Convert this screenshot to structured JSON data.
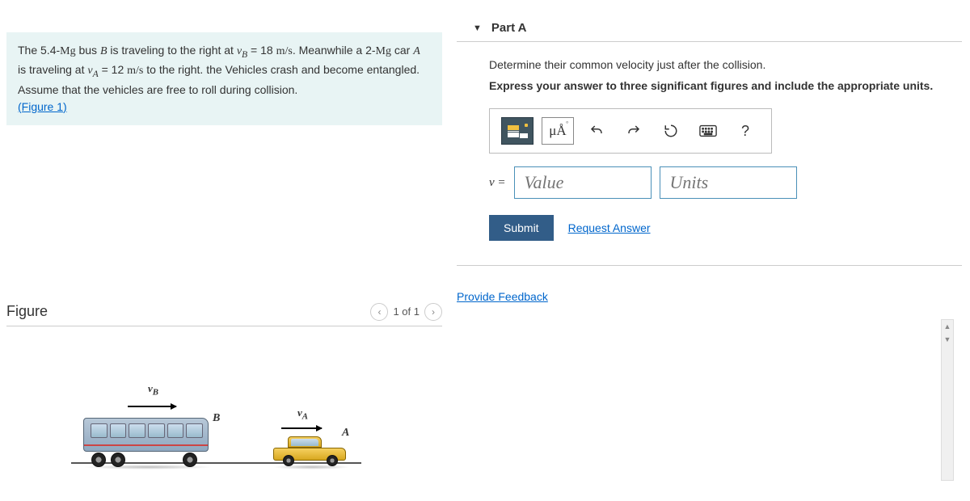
{
  "problem": {
    "text_prefix": "The 5.4-",
    "unit_mg": "Mg",
    "text_bus": " bus ",
    "var_B": "B",
    "text_travel_b": " is traveling to the right at ",
    "var_vb": "v",
    "sub_b": "B",
    "text_eq_b": " = 18 ",
    "unit_ms": "m/s",
    "text_meanwhile": ". Meanwhile a 2-",
    "text_car": " car ",
    "var_A": "A",
    "text_travel_a": " is traveling at ",
    "var_va": "v",
    "sub_a": "A",
    "text_eq_a": " = 12 ",
    "text_rest": " to the right. the Vehicles crash and become entangled. Assume that the vehicles are free to roll during collision.",
    "figure_link": "(Figure 1)"
  },
  "figure": {
    "title": "Figure",
    "counter": "1 of 1",
    "label_vb": "v",
    "label_vb_sub": "B",
    "label_va": "v",
    "label_va_sub": "A",
    "label_B": "B",
    "label_A": "A"
  },
  "part": {
    "header": "Part A",
    "prompt1": "Determine their common velocity just after the collision.",
    "prompt2": "Express your answer to three significant figures and include the appropriate units."
  },
  "toolbar": {
    "units_btn": "μÅ",
    "help": "?"
  },
  "answer": {
    "label": "v =",
    "value_placeholder": "Value",
    "units_placeholder": "Units"
  },
  "actions": {
    "submit": "Submit",
    "request": "Request Answer",
    "feedback": "Provide Feedback"
  }
}
